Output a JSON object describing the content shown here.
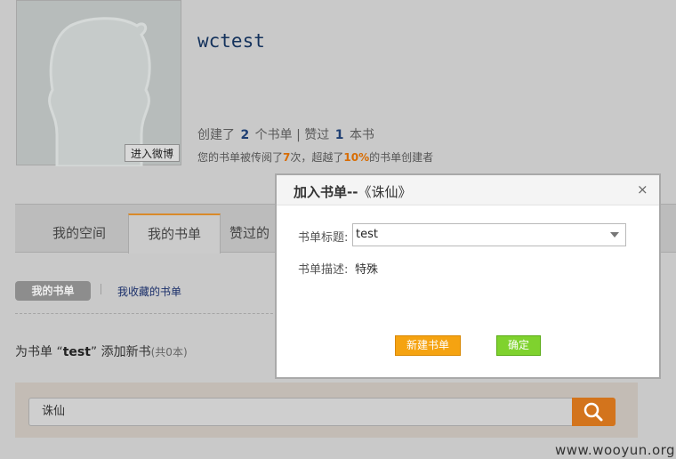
{
  "profile": {
    "weibo_button": "进入微博",
    "username": "wctest",
    "stats": {
      "created_prefix": "创建了",
      "created_count": "2",
      "created_suffix": "个书单 | 赞过",
      "liked_count": "1",
      "liked_suffix": "本书"
    },
    "reads": {
      "prefix": "您的书单被传阅了",
      "times": "7",
      "mid": "次，超越了",
      "percent": "10%",
      "suffix": "的书单创建者"
    }
  },
  "tabs": [
    {
      "label": "我的空间"
    },
    {
      "label": "我的书单"
    },
    {
      "label": "赞过的"
    }
  ],
  "subnav": {
    "mine": "我的书单",
    "separator": "|",
    "collected": "我收藏的书单"
  },
  "add_heading": {
    "prefix": "为书单 “",
    "name": "test",
    "suffix": "” 添加新书",
    "count": "(共0本)"
  },
  "search": {
    "value": "诛仙",
    "button_icon": "search-icon"
  },
  "dialog": {
    "title_bold": "加入书单--",
    "title_book": "《诛仙》",
    "close": "×",
    "title_label": "书单标题:",
    "title_selected": "test",
    "desc_label": "书单描述:",
    "desc_value": "特殊",
    "new_button": "新建书单",
    "ok_button": "确定"
  },
  "watermark": "www.wooyun.org",
  "colors": {
    "accent_orange": "#d3741c",
    "new_button": "#f5a311",
    "ok_button": "#7fd22e",
    "username": "#14325c"
  }
}
